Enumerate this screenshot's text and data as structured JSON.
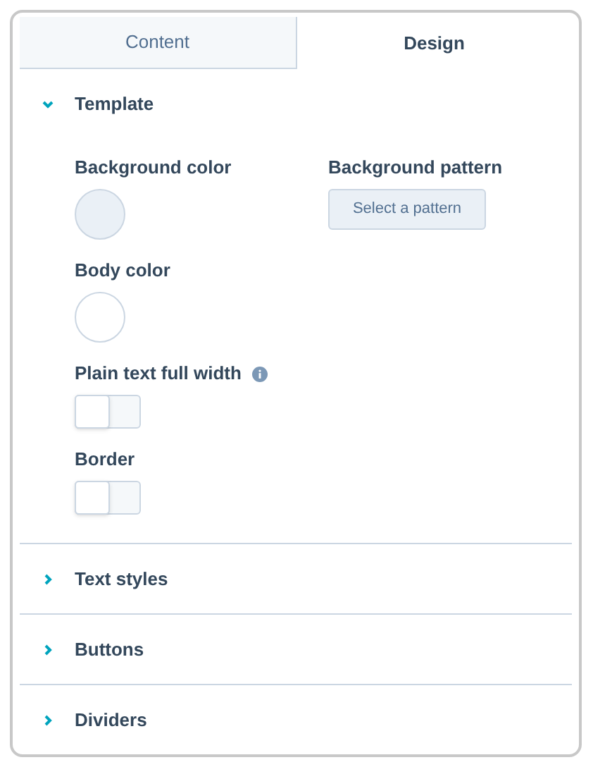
{
  "tabs": [
    {
      "label": "Content",
      "selected": false
    },
    {
      "label": "Design",
      "selected": true
    }
  ],
  "sections": [
    {
      "title": "Template",
      "expanded": true,
      "rows": [
        [
          {
            "kind": "color",
            "label": "Background color",
            "color": "#eaf0f6"
          },
          {
            "kind": "pattern",
            "label": "Background pattern",
            "button": "Select a pattern"
          }
        ],
        [
          {
            "kind": "color",
            "label": "Body color",
            "color": "#ffffff"
          }
        ],
        [
          {
            "kind": "toggle",
            "label": "Plain text full width",
            "info": true,
            "on": false
          }
        ],
        [
          {
            "kind": "toggle",
            "label": "Border",
            "info": false,
            "on": false
          }
        ]
      ]
    },
    {
      "title": "Text styles",
      "expanded": false
    },
    {
      "title": "Buttons",
      "expanded": false
    },
    {
      "title": "Dividers",
      "expanded": false
    }
  ]
}
